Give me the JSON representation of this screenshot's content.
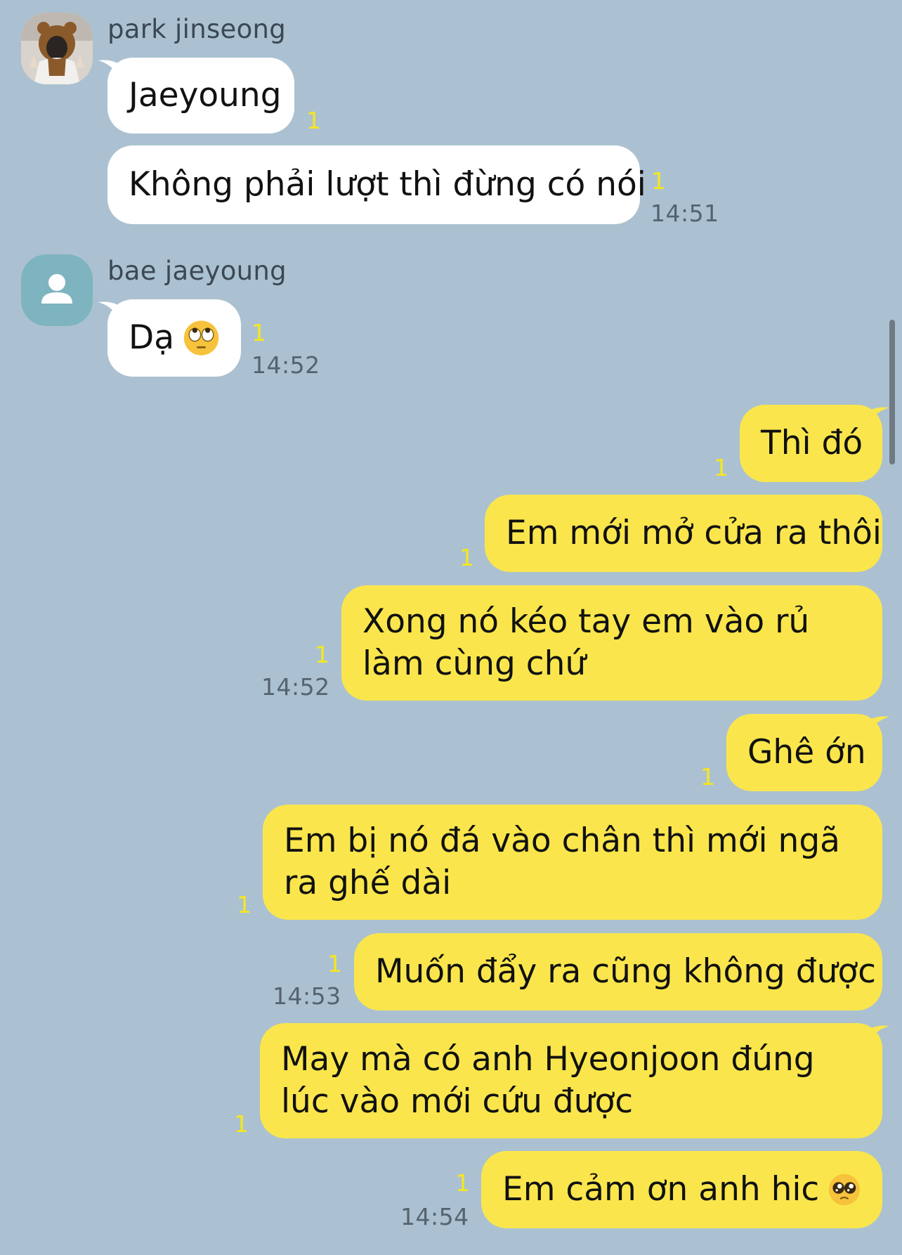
{
  "thread": [
    {
      "sender": "park jinseong"
    },
    {
      "sender": "bae jaeyoung"
    }
  ],
  "messages": [
    {
      "text": "Jaeyoung",
      "unread": "1"
    },
    {
      "text": "Không phải lượt thì đừng có nói",
      "unread": "1",
      "time": "14:51"
    },
    {
      "text": "Dạ",
      "emoji": "eye-roll-emoji",
      "unread": "1",
      "time": "14:52"
    },
    {
      "text": "Thì đó",
      "unread": "1"
    },
    {
      "text": "Em mới mở cửa ra thôi",
      "unread": "1"
    },
    {
      "text": "Xong nó kéo tay em vào rủ làm cùng chứ",
      "unread": "1",
      "time": "14:52"
    },
    {
      "text": "Ghê ớn",
      "unread": "1"
    },
    {
      "text": "Em bị nó đá vào chân thì mới ngã ra ghế dài",
      "unread": "1"
    },
    {
      "text": "Muốn đẩy ra cũng không được",
      "unread": "1",
      "time": "14:53"
    },
    {
      "text": "May mà có anh Hyeonjoon đúng lúc vào mới cứu được",
      "unread": "1"
    },
    {
      "text": "Em cảm ơn anh hic",
      "emoji": "pleading-face-emoji",
      "unread": "1",
      "time": "14:54"
    }
  ],
  "colors": {
    "background": "#abc1d1",
    "incoming_bubble": "#ffffff",
    "outgoing_bubble": "#fae64c",
    "unread_count": "#f5e61f",
    "timestamp": "#55636f"
  }
}
